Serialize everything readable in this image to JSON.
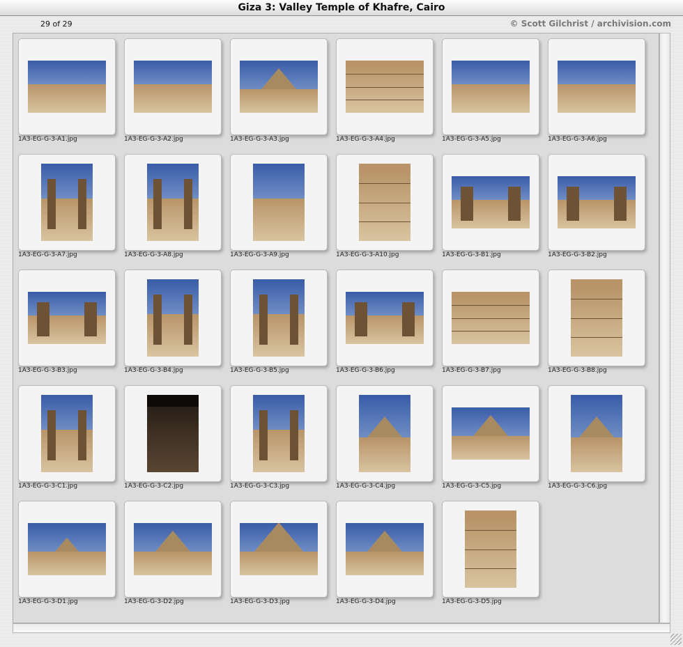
{
  "window": {
    "title": "Giza 3: Valley Temple of Khafre, Cairo"
  },
  "header": {
    "count": "29 of 29",
    "credit": "© Scott Gilchrist / archivision.com"
  },
  "thumbnails": [
    {
      "file": "1A3-EG-G-3-A1.jpg",
      "orientation": "landscape",
      "subject": "ruins"
    },
    {
      "file": "1A3-EG-G-3-A2.jpg",
      "orientation": "landscape",
      "subject": "ruins"
    },
    {
      "file": "1A3-EG-G-3-A3.jpg",
      "orientation": "landscape",
      "subject": "ruins-pyramid"
    },
    {
      "file": "1A3-EG-G-3-A4.jpg",
      "orientation": "landscape",
      "subject": "stone-passage"
    },
    {
      "file": "1A3-EG-G-3-A5.jpg",
      "orientation": "landscape",
      "subject": "ruins"
    },
    {
      "file": "1A3-EG-G-3-A6.jpg",
      "orientation": "landscape",
      "subject": "ruins"
    },
    {
      "file": "1A3-EG-G-3-A7.jpg",
      "orientation": "portrait",
      "subject": "temple-path"
    },
    {
      "file": "1A3-EG-G-3-A8.jpg",
      "orientation": "portrait",
      "subject": "doorway"
    },
    {
      "file": "1A3-EG-G-3-A9.jpg",
      "orientation": "portrait",
      "subject": "ruins"
    },
    {
      "file": "1A3-EG-G-3-A10.jpg",
      "orientation": "portrait",
      "subject": "wall"
    },
    {
      "file": "1A3-EG-G-3-B1.jpg",
      "orientation": "landscape",
      "subject": "pillars"
    },
    {
      "file": "1A3-EG-G-3-B2.jpg",
      "orientation": "landscape",
      "subject": "pillars"
    },
    {
      "file": "1A3-EG-G-3-B3.jpg",
      "orientation": "landscape",
      "subject": "pillars"
    },
    {
      "file": "1A3-EG-G-3-B4.jpg",
      "orientation": "portrait",
      "subject": "pillars"
    },
    {
      "file": "1A3-EG-G-3-B5.jpg",
      "orientation": "portrait",
      "subject": "pillars"
    },
    {
      "file": "1A3-EG-G-3-B6.jpg",
      "orientation": "landscape",
      "subject": "beams"
    },
    {
      "file": "1A3-EG-G-3-B7.jpg",
      "orientation": "landscape",
      "subject": "granite-wall"
    },
    {
      "file": "1A3-EG-G-3-B8.jpg",
      "orientation": "portrait",
      "subject": "granite-wall"
    },
    {
      "file": "1A3-EG-G-3-C1.jpg",
      "orientation": "portrait",
      "subject": "pillars"
    },
    {
      "file": "1A3-EG-G-3-C2.jpg",
      "orientation": "portrait",
      "subject": "dark-corridor"
    },
    {
      "file": "1A3-EG-G-3-C3.jpg",
      "orientation": "portrait",
      "subject": "corridor"
    },
    {
      "file": "1A3-EG-G-3-C4.jpg",
      "orientation": "portrait",
      "subject": "causeway-pyramid"
    },
    {
      "file": "1A3-EG-G-3-C5.jpg",
      "orientation": "landscape",
      "subject": "sphinx-pyramid"
    },
    {
      "file": "1A3-EG-G-3-C6.jpg",
      "orientation": "portrait",
      "subject": "causeway-pyramid"
    },
    {
      "file": "1A3-EG-G-3-D1.jpg",
      "orientation": "landscape",
      "subject": "pyramid-far"
    },
    {
      "file": "1A3-EG-G-3-D2.jpg",
      "orientation": "landscape",
      "subject": "pyramid"
    },
    {
      "file": "1A3-EG-G-3-D3.jpg",
      "orientation": "landscape",
      "subject": "pyramid-near"
    },
    {
      "file": "1A3-EG-G-3-D4.jpg",
      "orientation": "landscape",
      "subject": "pyramid"
    },
    {
      "file": "1A3-EG-G-3-D5.jpg",
      "orientation": "portrait",
      "subject": "stone-close"
    }
  ],
  "colors": {
    "sky": "#3a5ca8",
    "stone": "#b89468",
    "stoneDark": "#6e5235",
    "sand": "#d8c4a0",
    "shadow": "#2a2018"
  }
}
